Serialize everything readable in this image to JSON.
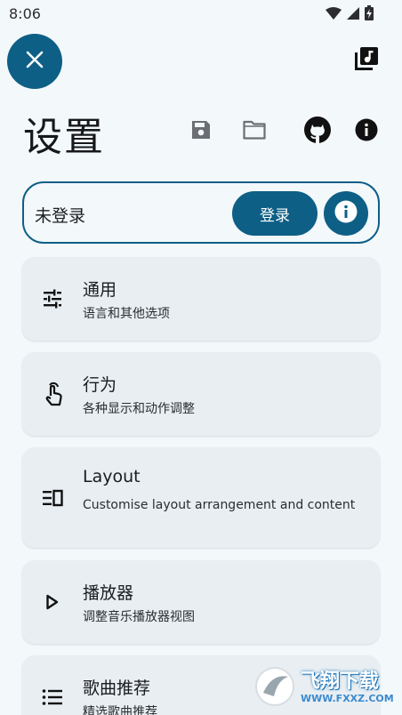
{
  "status_bar": {
    "time": "8:06",
    "icons": [
      "wifi-icon",
      "signal-icon",
      "battery-icon"
    ]
  },
  "header": {
    "close_icon": "close-icon",
    "music_library_icon": "music-library-icon",
    "title": "设置",
    "actions": [
      "save-icon",
      "folder-icon",
      "github-icon",
      "info-icon"
    ]
  },
  "account": {
    "status": "未登录",
    "login_label": "登录",
    "info_icon": "info-icon"
  },
  "menu": [
    {
      "id": "general",
      "icon": "tune-icon",
      "title": "通用",
      "subtitle": "语言和其他选项"
    },
    {
      "id": "behaviour",
      "icon": "touch-icon",
      "title": "行为",
      "subtitle": "各种显示和动作调整"
    },
    {
      "id": "layout",
      "icon": "layout-icon",
      "title": "Layout",
      "subtitle": "Customise layout arrangement and content"
    },
    {
      "id": "player",
      "icon": "play-icon",
      "title": "播放器",
      "subtitle": "调整音乐播放器视图"
    },
    {
      "id": "recommend",
      "icon": "list-icon",
      "title": "歌曲推荐",
      "subtitle": "精选歌曲推荐"
    }
  ],
  "watermark": {
    "main": "飞翔下载",
    "sub": "WWW.FXXZ.COM"
  },
  "colors": {
    "accent": "#0e5f86",
    "background": "#f3f8fb",
    "card": "#e8eef2"
  }
}
